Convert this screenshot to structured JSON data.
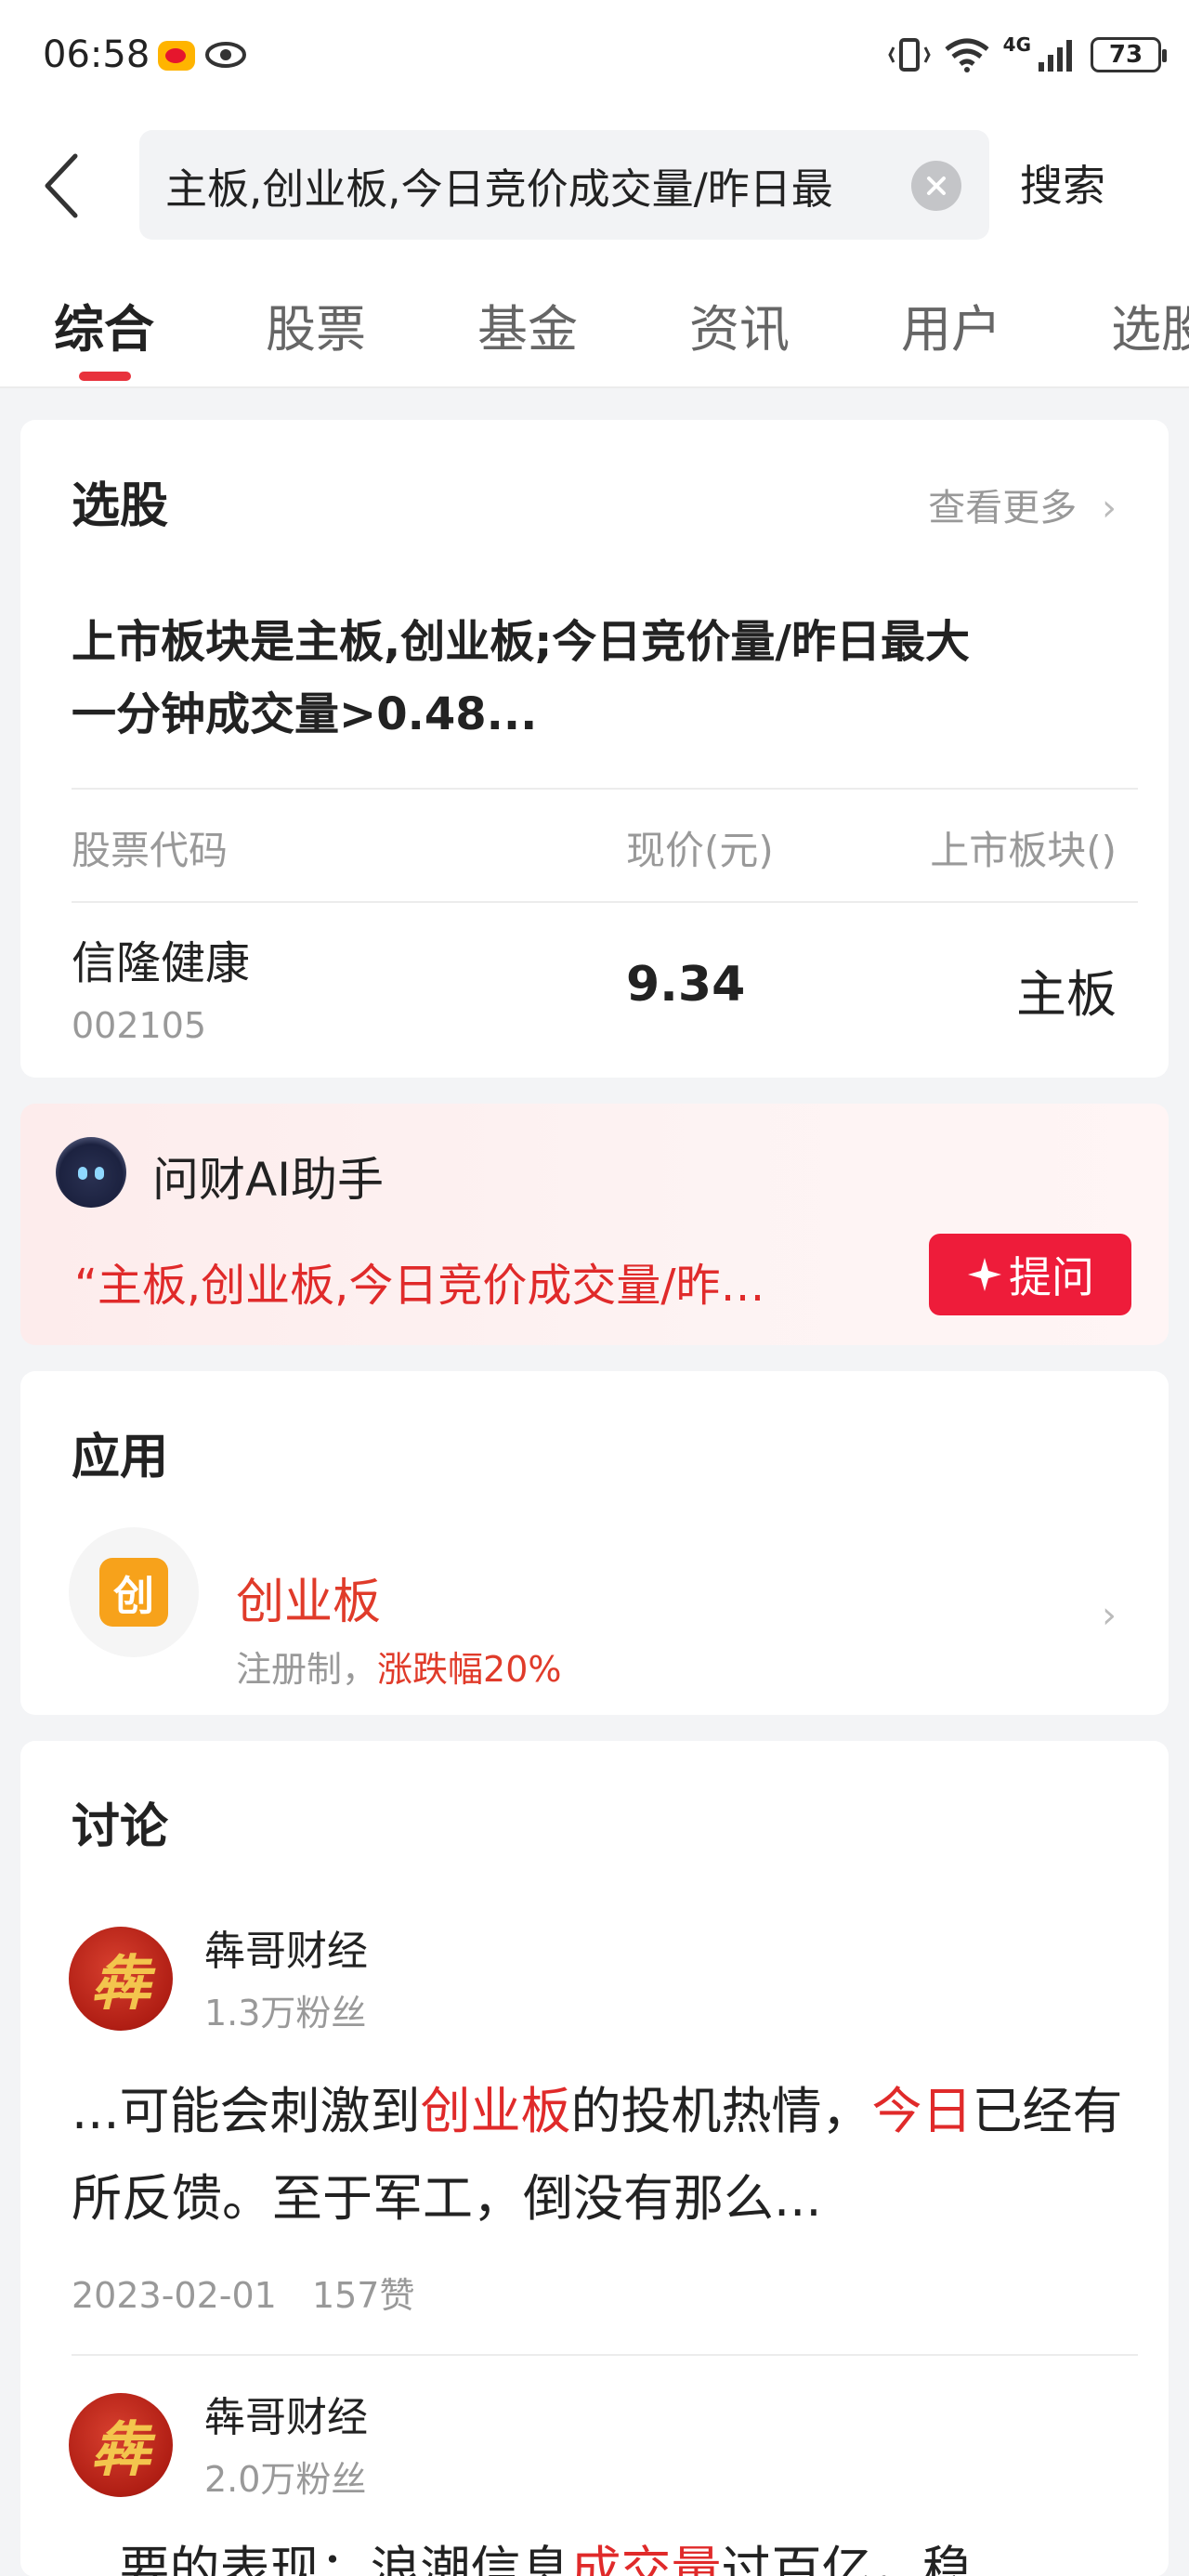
{
  "status_bar": {
    "time": "06:58",
    "network": "4G",
    "battery": "73"
  },
  "search": {
    "value": "主板,创业板,今日竞价成交量/昨日最",
    "submit_label": "搜索"
  },
  "tabs": [
    "综合",
    "股票",
    "基金",
    "资讯",
    "用户",
    "选股"
  ],
  "stock_picker": {
    "title": "选股",
    "more": "查看更多",
    "query": "上市板块是主板,创业板;今日竞价量/昨日最大一分钟成交量>0.48...",
    "columns": [
      "股票代码",
      "现价(元)",
      "上市板块()"
    ],
    "rows": [
      {
        "name": "信隆健康",
        "code": "002105",
        "price": "9.34",
        "board": "主板"
      }
    ]
  },
  "ai_assistant": {
    "title": "问财AI助手",
    "quote": "“主板,创业板,今日竞价成交量/昨…",
    "ask_label": "提问"
  },
  "apps": {
    "title": "应用",
    "items": [
      {
        "icon_text": "创",
        "name": "创业板",
        "desc_prefix": "注册制，",
        "desc_highlight": "涨跌幅20%"
      }
    ]
  },
  "discussion": {
    "title": "讨论",
    "posts": [
      {
        "avatar_text": "犇",
        "user": "犇哥财经",
        "fans": "1.3万粉丝",
        "body_1": "...可能会刺激到",
        "hl_1": "创业板",
        "body_2": "的投机热情，",
        "hl_2": "今日",
        "body_3": "已经有所反馈。至于军工，倒没有那么...",
        "date": "2023-02-01",
        "likes": "157赞"
      },
      {
        "avatar_text": "犇",
        "user": "犇哥财经",
        "fans": "2.0万粉丝",
        "body_1": "...要的表现：浪潮信息",
        "hl_1": "成交量",
        "body_2": "过百亿，稳"
      }
    ]
  }
}
